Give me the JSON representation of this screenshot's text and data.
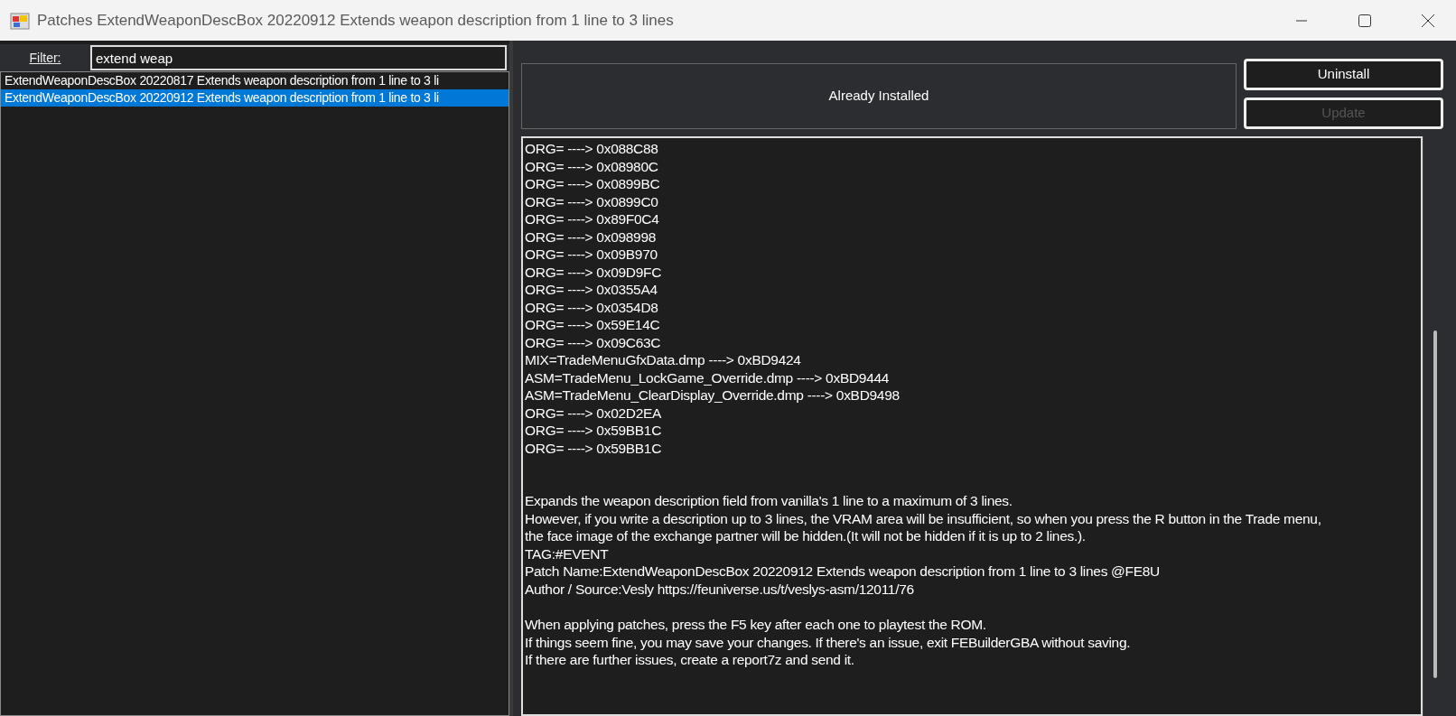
{
  "window": {
    "title": "Patches ExtendWeaponDescBox 20220912 Extends weapon description from 1 line to 3 lines"
  },
  "filter": {
    "label": "Filter:",
    "value": "extend weap"
  },
  "patch_list": [
    {
      "text": "ExtendWeaponDescBox 20220817 Extends weapon description from 1 line to 3 li",
      "selected": false
    },
    {
      "text": "ExtendWeaponDescBox 20220912 Extends weapon description from 1 line to 3 li",
      "selected": true
    }
  ],
  "status": {
    "text": "Already Installed"
  },
  "buttons": [
    {
      "label": "Uninstall",
      "disabled": false
    },
    {
      "label": "Update",
      "disabled": true
    }
  ],
  "details": {
    "blocks": [
      {
        "lines": [
          "ORG= ----> 0x088C88",
          "ORG= ----> 0x08980C",
          "ORG= ----> 0x0899BC",
          "ORG= ----> 0x0899C0",
          "ORG= ----> 0x89F0C4",
          "ORG= ----> 0x098998",
          "ORG= ----> 0x09B970",
          "ORG= ----> 0x09D9FC",
          "ORG= ----> 0x0355A4",
          "ORG= ----> 0x0354D8",
          "ORG= ----> 0x59E14C",
          "ORG= ----> 0x09C63C",
          "MIX=TradeMenuGfxData.dmp ----> 0xBD9424",
          "ASM=TradeMenu_LockGame_Override.dmp ----> 0xBD9444",
          "ASM=TradeMenu_ClearDisplay_Override.dmp ----> 0xBD9498",
          "ORG= ----> 0x02D2EA",
          "ORG= ----> 0x59BB1C",
          "ORG= ----> 0x59BB1C"
        ]
      },
      {
        "lines": [
          "Expands the weapon description field from vanilla's 1 line to a maximum of 3 lines.",
          "However, if you write a description up to 3 lines, the VRAM area will be insufficient, so when you press the R button in the Trade menu,",
          "the face image of the exchange partner will be hidden.(It will not be hidden if it is up to 2 lines.).",
          "TAG:#EVENT",
          "Patch Name:ExtendWeaponDescBox 20220912 Extends weapon description from 1 line to 3 lines  @FE8U",
          "Author / Source:Vesly https://feuniverse.us/t/veslys-asm/12011/76"
        ]
      },
      {
        "lines": [
          "When applying patches, press the F5 key after each one to playtest the ROM.",
          "If things seem fine, you may save your changes. If there's an issue, exit FEBuilderGBA without saving.",
          "If there are further issues, create a report7z and send it."
        ]
      }
    ]
  }
}
